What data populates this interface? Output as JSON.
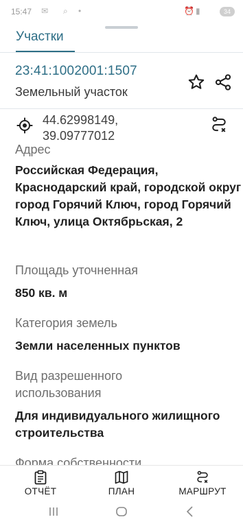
{
  "status_bar": {
    "time": "15:47",
    "battery": "34"
  },
  "sheet": {
    "tab_label": "Участки"
  },
  "parcel": {
    "cadastral_number": "23:41:1002001:1507",
    "object_type": "Земельный участок",
    "coordinates": "44.62998149, 39.09777012"
  },
  "details": [
    {
      "label": "Адрес",
      "value": "Российская Федерация, Краснодарский край, городской округ город Горячий Ключ, город Горячий Ключ, улица Октябрьская, 2"
    },
    {
      "label": "Площадь уточненная",
      "value": "850 кв. м"
    },
    {
      "label": "Категория земель",
      "value": "Земли населенных пунктов"
    },
    {
      "label": "Вид разрешенного использования",
      "value": "Для индивидуального жилищного строительства"
    },
    {
      "label": "Форма собственности",
      "value": ""
    }
  ],
  "bottom_nav": {
    "report": "ОТЧЁТ",
    "plan": "ПЛАН",
    "route": "МАРШРУТ"
  },
  "colors": {
    "accent": "#2d6e86",
    "label": "#6f6f6f",
    "value": "#222222"
  },
  "icons": [
    "star-outline-icon",
    "share-icon",
    "crosshair-icon",
    "route-icon",
    "report-icon",
    "map-icon",
    "recent-apps-icon",
    "home-icon",
    "back-icon"
  ]
}
